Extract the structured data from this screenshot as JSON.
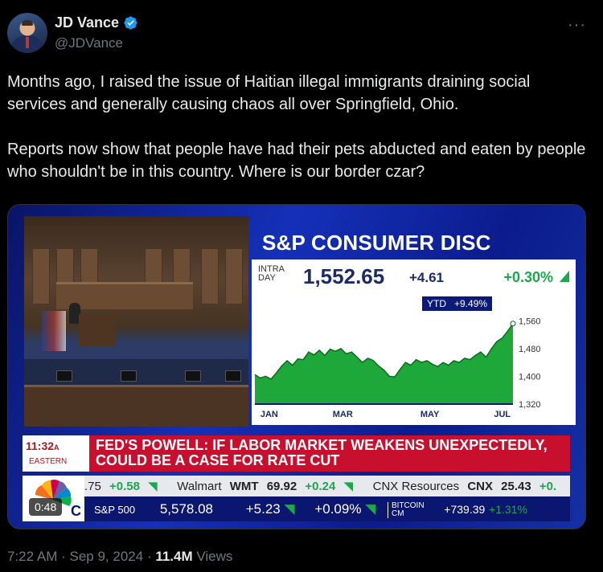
{
  "author": {
    "name": "JD Vance",
    "handle": "@JDVance",
    "verified": true,
    "verified_color": "#1d9bf0"
  },
  "more_icon": "more-horizontal-icon",
  "tweet": {
    "text": "Months ago, I raised the issue of Haitian illegal immigrants draining social services and generally causing chaos all over Springfield, Ohio.\n\nReports now show that people have had their pets abducted and eaten by people who shouldn't be in this country. Where is our border czar?"
  },
  "video": {
    "title": "S&P CONSUMER DISC",
    "intra_label": "INTRA\nDAY",
    "price": "1,552.65",
    "change": "+4.61",
    "pct_change": "+0.30%",
    "ytd_label": "YTD",
    "ytd_value": "+9.49%",
    "chart_data": {
      "type": "area",
      "x_labels": [
        "JAN",
        "MAR",
        "MAY",
        "JUL"
      ],
      "y_labels": [
        "1,560",
        "1,480",
        "1,400",
        "1,320"
      ],
      "ylim": [
        1320,
        1570
      ],
      "values": [
        1405,
        1395,
        1400,
        1392,
        1410,
        1430,
        1445,
        1432,
        1450,
        1448,
        1470,
        1462,
        1475,
        1460,
        1478,
        1472,
        1480,
        1465,
        1470,
        1455,
        1440,
        1452,
        1446,
        1430,
        1418,
        1400,
        1398,
        1420,
        1440,
        1432,
        1448,
        1440,
        1445,
        1435,
        1428,
        1440,
        1432,
        1445,
        1440,
        1452,
        1448,
        1460,
        1470,
        1455,
        1480,
        1500,
        1510,
        1530,
        1552
      ],
      "fill_color": "#1ea83a",
      "line_color": "#0c6a20"
    },
    "time": "11:32",
    "time_suffix": "A",
    "timezone": "EASTERN",
    "banner": "FED'S POWELL: IF LABOR MARKET WEAKENS UNEXPECTEDLY, COULD BE A CASE FOR RATE CUT",
    "ticker_top": [
      {
        "label": ".75",
        "change": "+0.58"
      },
      {
        "label": "Walmart",
        "symbol": "WMT",
        "price": "69.92",
        "change": "+0.24"
      },
      {
        "label": "CNX Resources",
        "symbol": "CNX",
        "price": "25.43",
        "change": "+0."
      }
    ],
    "ticker_bottom": {
      "index": "S&P 500",
      "value": "5,578.08",
      "change": "+5.23",
      "pct": "+0.09%",
      "crypto": "BITCOIN\nCM",
      "crypto_change": "+739.39",
      "crypto_pct": "+1.31%"
    },
    "duration": "0:48",
    "logo_fragment": "C"
  },
  "footer": {
    "time": "7:22 AM",
    "date": "Sep 9, 2024",
    "views": "11.4M",
    "views_label": "Views"
  }
}
